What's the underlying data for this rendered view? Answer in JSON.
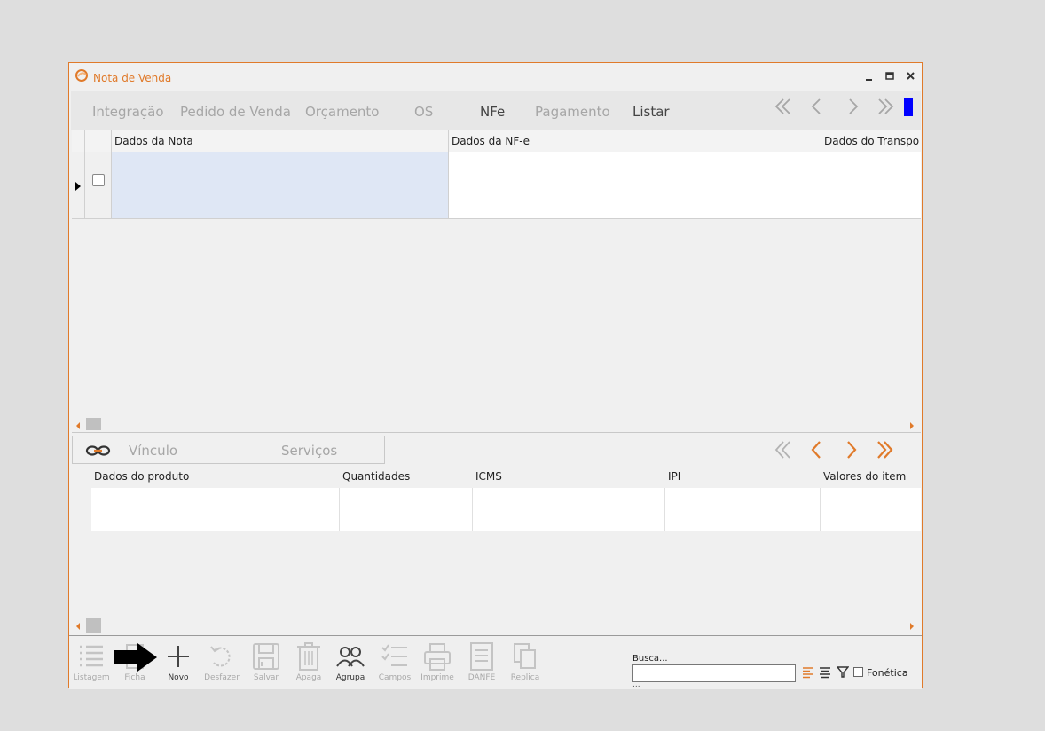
{
  "window": {
    "title": "Nota de Venda",
    "controls": [
      "minimize",
      "maximize",
      "close"
    ]
  },
  "tabs": [
    {
      "label": "Integração",
      "active": false
    },
    {
      "label": "Pedido de Venda",
      "active": false
    },
    {
      "label": "Orçamento",
      "active": false
    },
    {
      "label": "OS",
      "active": false
    },
    {
      "label": "NFe",
      "active": true
    },
    {
      "label": "Pagamento",
      "active": false
    },
    {
      "label": "Listar",
      "active": true
    }
  ],
  "nav_icons": [
    "first-record-icon",
    "prev-record-icon",
    "next-record-icon",
    "last-record-icon"
  ],
  "accent_color": "#e07a2a",
  "marker_color": "#0000ff",
  "main_grid": {
    "columns": [
      "Dados da Nota",
      "Dados da NF-e",
      "Dados do Transpo"
    ]
  },
  "subtabs": [
    {
      "label": "Vínculo",
      "icon": "link-icon"
    },
    {
      "label": "Serviços"
    }
  ],
  "detail_grid": {
    "columns": [
      "Dados do produto",
      "Quantidades",
      "ICMS",
      "IPI",
      "Valores do item"
    ]
  },
  "toolbar": {
    "buttons": [
      {
        "label": "Listagem",
        "icon": "list-icon",
        "enabled": false
      },
      {
        "label": "Ficha",
        "icon": "form-icon",
        "enabled": false
      },
      {
        "label": "Novo",
        "icon": "plus-icon",
        "enabled": true
      },
      {
        "label": "Desfazer",
        "icon": "undo-icon",
        "enabled": false
      },
      {
        "label": "Salvar",
        "icon": "save-icon",
        "enabled": false
      },
      {
        "label": "Apaga",
        "icon": "trash-icon",
        "enabled": false
      },
      {
        "label": "Agrupa",
        "icon": "group-icon",
        "enabled": true
      },
      {
        "label": "Campos",
        "icon": "fields-icon",
        "enabled": false
      },
      {
        "label": "Imprime",
        "icon": "print-icon",
        "enabled": false
      },
      {
        "label": "DANFE",
        "icon": "danfe-icon",
        "enabled": false
      },
      {
        "label": "Replica",
        "icon": "copy-icon",
        "enabled": false
      }
    ]
  },
  "search": {
    "label": "Busca...",
    "value": "",
    "dots": "...",
    "fonetica_label": "Fonética"
  }
}
